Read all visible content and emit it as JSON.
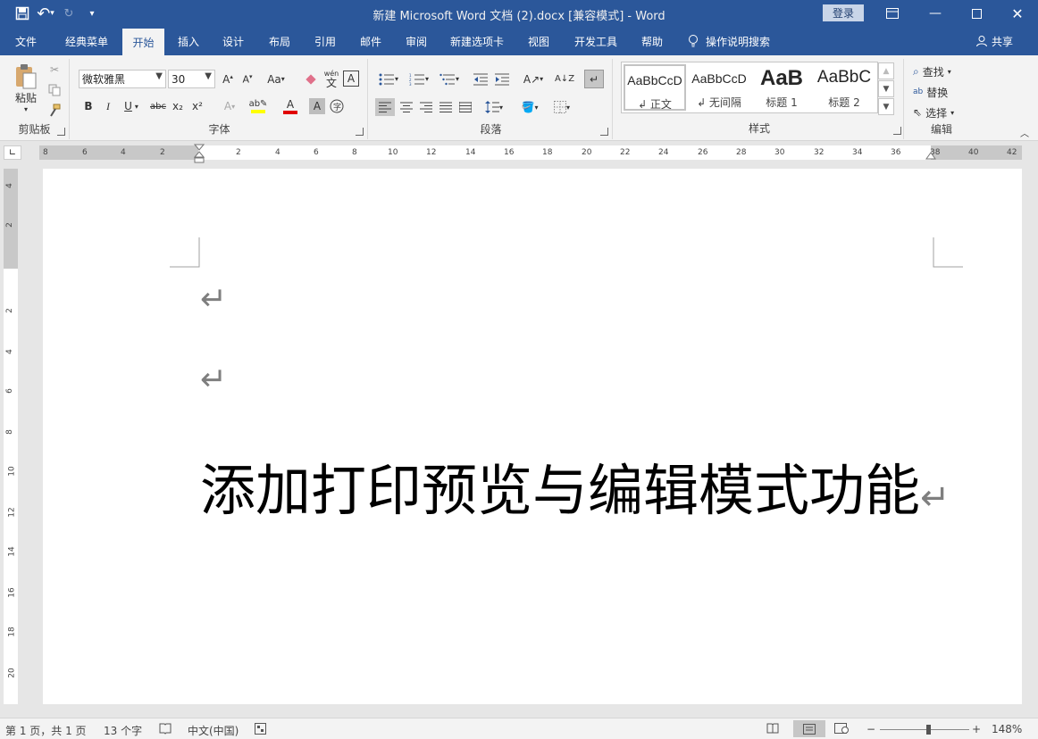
{
  "titlebar": {
    "title": "新建 Microsoft Word 文档 (2).docx [兼容模式]  -  Word",
    "login": "登录",
    "qat": {
      "save": "save-icon",
      "undo": "↶",
      "redo": "↻",
      "customize": "▾"
    }
  },
  "tabs": [
    "文件",
    "经典菜单",
    "开始",
    "插入",
    "设计",
    "布局",
    "引用",
    "邮件",
    "审阅",
    "新建选项卡",
    "视图",
    "开发工具",
    "帮助"
  ],
  "active_tab": "开始",
  "tellme": "操作说明搜索",
  "share": "共享",
  "ribbon": {
    "clipboard": {
      "paste": "粘贴",
      "label": "剪贴板"
    },
    "font": {
      "name": "微软雅黑",
      "size": "30",
      "bold": "B",
      "italic": "I",
      "underline": "U",
      "strike": "abc",
      "sub": "x₂",
      "sup": "x²",
      "change_case": "Aa",
      "phonetic": "wén",
      "label": "字体"
    },
    "paragraph": {
      "label": "段落"
    },
    "styles": {
      "items": [
        {
          "sample": "AaBbCcD",
          "name": "↲ 正文"
        },
        {
          "sample": "AaBbCcD",
          "name": "↲ 无间隔"
        },
        {
          "sample": "AaB",
          "name": "标题 1"
        },
        {
          "sample": "AaBbC",
          "name": "标题 2"
        }
      ],
      "label": "样式"
    },
    "editing": {
      "find": "查找",
      "replace": "替换",
      "select": "选择",
      "label": "编辑"
    }
  },
  "ruler": {
    "h_left": [
      "8",
      "6",
      "4",
      "2"
    ],
    "h_right": [
      "2",
      "4",
      "6",
      "8",
      "10",
      "12",
      "14",
      "16",
      "18",
      "20",
      "22",
      "24",
      "26",
      "28",
      "30",
      "32",
      "34",
      "36",
      "38",
      "40",
      "42"
    ],
    "v_top": [
      "4",
      "2"
    ],
    "v_body": [
      "2",
      "4",
      "6",
      "8",
      "10",
      "12",
      "14",
      "16",
      "18",
      "20"
    ]
  },
  "document": {
    "heading": "添加打印预览与编辑模式功能",
    "para_mark": "↵"
  },
  "statusbar": {
    "page": "第 1 页，共 1 页",
    "words": "13 个字",
    "language": "中文(中国)",
    "zoom": "148%"
  }
}
